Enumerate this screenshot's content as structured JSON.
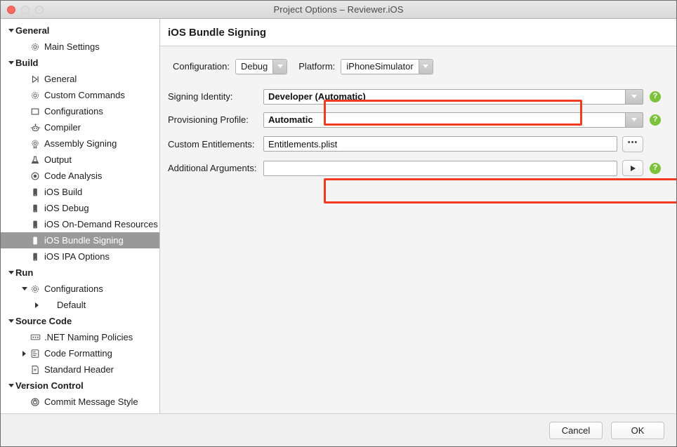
{
  "window": {
    "title": "Project Options – Reviewer.iOS",
    "traffic_lights": [
      "close",
      "minimize",
      "maximize"
    ]
  },
  "sidebar": {
    "items": [
      {
        "label": "General",
        "depth": 0,
        "group": true,
        "twisty": "down",
        "icon": null,
        "selected": false
      },
      {
        "label": "Main Settings",
        "depth": 1,
        "group": false,
        "twisty": null,
        "icon": "gear-icon",
        "selected": false
      },
      {
        "label": "Build",
        "depth": 0,
        "group": true,
        "twisty": "down",
        "icon": null,
        "selected": false
      },
      {
        "label": "General",
        "depth": 1,
        "group": false,
        "twisty": null,
        "icon": "build-general-icon",
        "selected": false
      },
      {
        "label": "Custom Commands",
        "depth": 1,
        "group": false,
        "twisty": null,
        "icon": "gear-icon",
        "selected": false
      },
      {
        "label": "Configurations",
        "depth": 1,
        "group": false,
        "twisty": null,
        "icon": "square-icon",
        "selected": false
      },
      {
        "label": "Compiler",
        "depth": 1,
        "group": false,
        "twisty": null,
        "icon": "compiler-icon",
        "selected": false
      },
      {
        "label": "Assembly Signing",
        "depth": 1,
        "group": false,
        "twisty": null,
        "icon": "seal-icon",
        "selected": false
      },
      {
        "label": "Output",
        "depth": 1,
        "group": false,
        "twisty": null,
        "icon": "flask-icon",
        "selected": false
      },
      {
        "label": "Code Analysis",
        "depth": 1,
        "group": false,
        "twisty": null,
        "icon": "radio-dot-icon",
        "selected": false
      },
      {
        "label": "iOS Build",
        "depth": 1,
        "group": false,
        "twisty": null,
        "icon": "iphone-icon",
        "selected": false
      },
      {
        "label": "iOS Debug",
        "depth": 1,
        "group": false,
        "twisty": null,
        "icon": "iphone-icon",
        "selected": false
      },
      {
        "label": "iOS On-Demand Resources",
        "depth": 1,
        "group": false,
        "twisty": null,
        "icon": "iphone-icon",
        "selected": false
      },
      {
        "label": "iOS Bundle Signing",
        "depth": 1,
        "group": false,
        "twisty": null,
        "icon": "iphone-icon",
        "selected": true
      },
      {
        "label": "iOS IPA Options",
        "depth": 1,
        "group": false,
        "twisty": null,
        "icon": "iphone-icon",
        "selected": false
      },
      {
        "label": "Run",
        "depth": 0,
        "group": true,
        "twisty": "down",
        "icon": null,
        "selected": false
      },
      {
        "label": "Configurations",
        "depth": 2,
        "group": false,
        "twisty": "down",
        "icon": "gear-icon",
        "selected": false
      },
      {
        "label": "Default",
        "depth": 3,
        "group": false,
        "twisty": "right",
        "icon": null,
        "selected": false
      },
      {
        "label": "Source Code",
        "depth": 0,
        "group": true,
        "twisty": "down",
        "icon": null,
        "selected": false
      },
      {
        "label": ".NET Naming Policies",
        "depth": 1,
        "group": false,
        "twisty": null,
        "icon": "naming-policy-icon",
        "selected": false
      },
      {
        "label": "Code Formatting",
        "depth": 2,
        "group": false,
        "twisty": "right",
        "icon": "code-format-icon",
        "selected": false
      },
      {
        "label": "Standard Header",
        "depth": 1,
        "group": false,
        "twisty": null,
        "icon": "hash-doc-icon",
        "selected": false
      },
      {
        "label": "Version Control",
        "depth": 0,
        "group": true,
        "twisty": "down",
        "icon": null,
        "selected": false
      },
      {
        "label": "Commit Message Style",
        "depth": 1,
        "group": false,
        "twisty": null,
        "icon": "target-icon",
        "selected": false
      }
    ]
  },
  "content": {
    "header_title": "iOS Bundle Signing",
    "config_row": {
      "configuration_label": "Configuration:",
      "configuration_value": "Debug",
      "platform_label": "Platform:",
      "platform_value": "iPhoneSimulator"
    },
    "fields": [
      {
        "label": "Signing Identity:",
        "value": "Developer (Automatic)",
        "bold": true,
        "control": "dropdown",
        "help": true
      },
      {
        "label": "Provisioning Profile:",
        "value": "Automatic",
        "bold": true,
        "control": "dropdown",
        "help": true
      },
      {
        "label": "Custom Entitlements:",
        "value": "Entitlements.plist",
        "bold": false,
        "control": "browse",
        "help": false
      },
      {
        "label": "Additional Arguments:",
        "value": "",
        "bold": false,
        "control": "play",
        "help": true
      }
    ],
    "browse_button_label": "•••",
    "annotations": {
      "color": "#f03b20",
      "boxes": [
        "configuration-platform-row",
        "custom-entitlements-row"
      ]
    }
  },
  "footer": {
    "cancel_label": "Cancel",
    "ok_label": "OK"
  }
}
